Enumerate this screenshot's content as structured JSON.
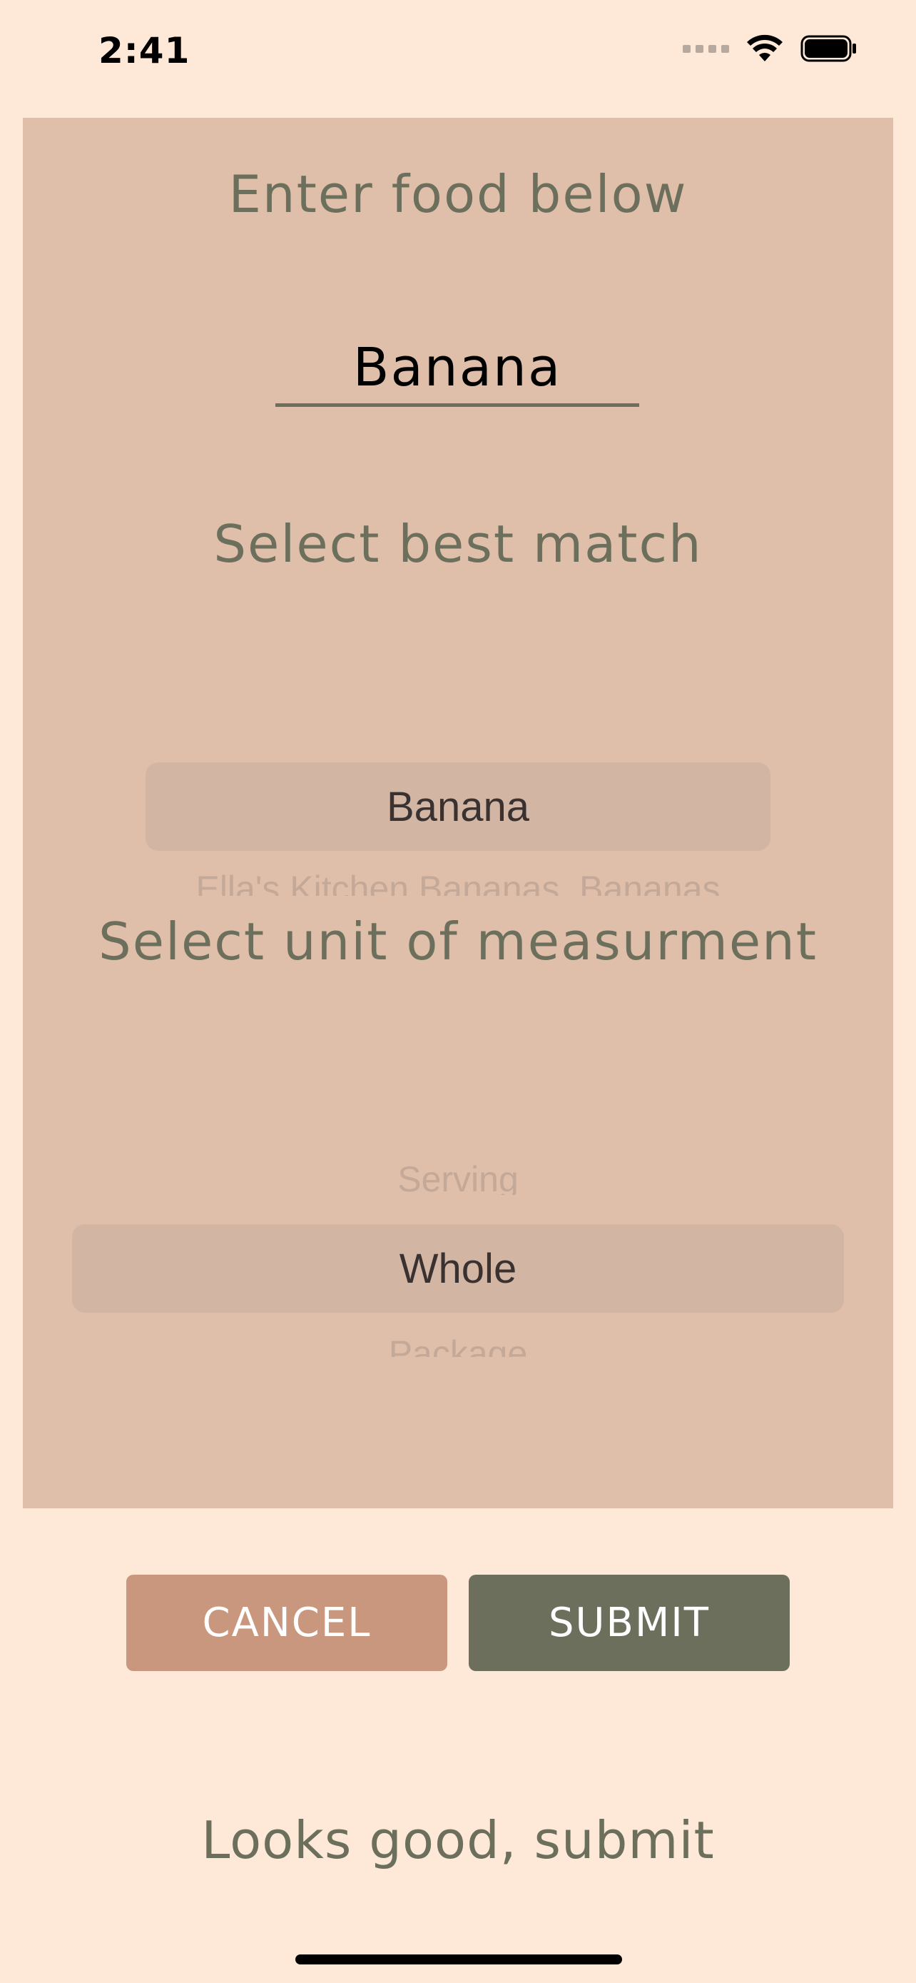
{
  "status_bar": {
    "time": "2:41",
    "icons": [
      "cellular-signal-icon",
      "wifi-icon",
      "battery-icon"
    ]
  },
  "form": {
    "food_heading": "Enter food below",
    "food_input_value": "Banana",
    "match_heading": "Select best match",
    "match_picker": {
      "selected": "Banana",
      "below": "Ella's Kitchen Bananas, Bananas"
    },
    "unit_heading": "Select unit of measurment",
    "unit_picker": {
      "above": "Serving",
      "selected": "Whole",
      "below": "Package"
    }
  },
  "actions": {
    "cancel_label": "CANCEL",
    "submit_label": "SUBMIT"
  },
  "hint": "Looks good, submit",
  "colors": {
    "background": "#fee8d8",
    "panel": "#dfbfa9",
    "accent_olive": "#6c6f5b",
    "cancel": "#c9977e"
  }
}
